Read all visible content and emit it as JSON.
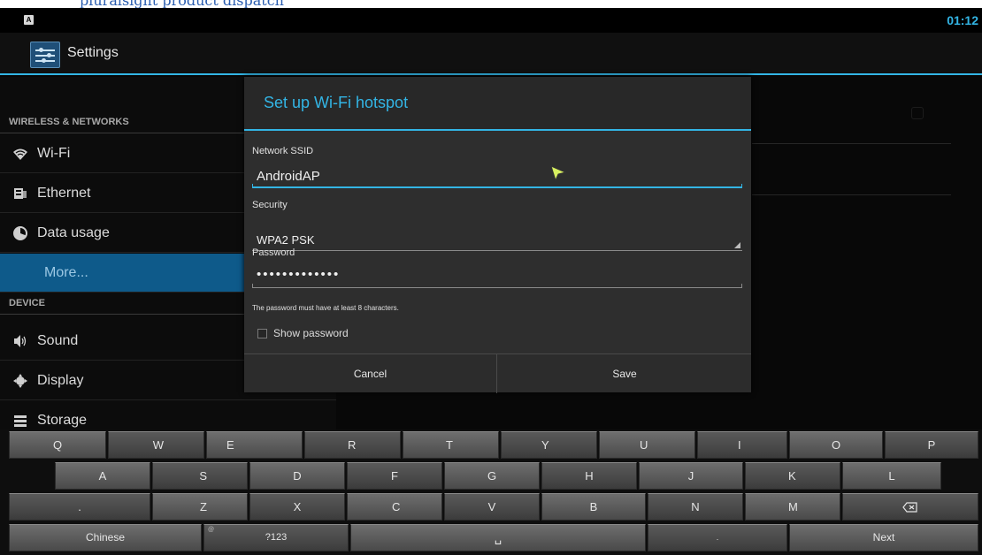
{
  "caption": "pluralsight product dispatch",
  "status_bar": {
    "notification_icon": "A",
    "clock": "01:12"
  },
  "action_bar": {
    "icon": "settings-icon",
    "title": "Settings"
  },
  "sidebar": {
    "sections": [
      {
        "header": "WIRELESS & NETWORKS"
      },
      {
        "header": "DEVICE"
      }
    ],
    "items": [
      {
        "icon": "wifi-icon",
        "label": "Wi-Fi"
      },
      {
        "icon": "ethernet-icon",
        "label": "Ethernet"
      },
      {
        "icon": "data-usage-icon",
        "label": "Data usage"
      },
      {
        "icon": "",
        "label": "More...",
        "selected": true
      },
      {
        "icon": "sound-icon",
        "label": "Sound"
      },
      {
        "icon": "display-icon",
        "label": "Display"
      },
      {
        "icon": "storage-icon",
        "label": "Storage"
      }
    ]
  },
  "dialog": {
    "title": "Set up Wi-Fi hotspot",
    "ssid_label": "Network SSID",
    "ssid_value": "AndroidAP",
    "security_label": "Security",
    "security_value": "WPA2 PSK",
    "password_label": "Password",
    "password_value": "•••••••••••••",
    "password_hint": "The password must have at least 8 characters.",
    "show_password_label": "Show password",
    "show_password_checked": false,
    "cancel_label": "Cancel",
    "save_label": "Save"
  },
  "keyboard": {
    "row1": [
      "Q",
      "W",
      "E",
      "R",
      "T",
      "Y",
      "U",
      "I",
      "O",
      "P"
    ],
    "row2": [
      "A",
      "S",
      "D",
      "F",
      "G",
      "H",
      "J",
      "K",
      "L"
    ],
    "row3": [
      ".",
      "Z",
      "X",
      "C",
      "V",
      "B",
      "N",
      "M",
      "DEL"
    ],
    "row4": [
      "Chinese",
      "?123",
      "␣",
      ".",
      "Next"
    ],
    "symbol_hint": "@"
  },
  "colors": {
    "accent": "#33b5e5",
    "selected_item": "#0e5a8a",
    "dialog_bg": "#2e2e2e"
  }
}
